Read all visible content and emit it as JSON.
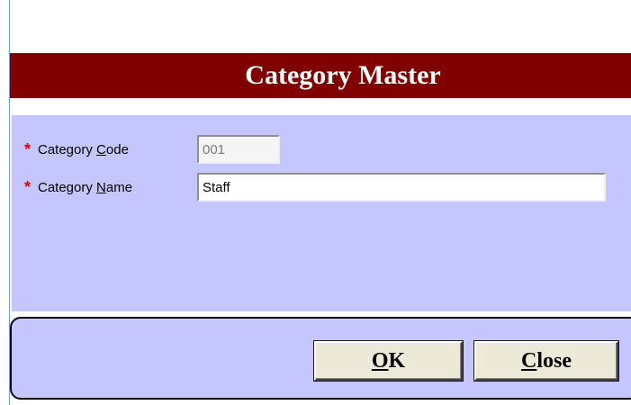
{
  "window": {
    "title": "Category Master",
    "title_bg": "#800000",
    "panel_bg": "#c6c6ff"
  },
  "form": {
    "code": {
      "required_mark": "*",
      "label_prefix": "Category ",
      "label_underlined": "C",
      "label_suffix": "ode",
      "value": "001"
    },
    "name": {
      "required_mark": "*",
      "label_prefix": "Category ",
      "label_underlined": "N",
      "label_suffix": "ame",
      "value": "Staff"
    }
  },
  "buttons": {
    "ok": {
      "underlined": "O",
      "rest": "K"
    },
    "close": {
      "underlined": "C",
      "rest": "lose"
    }
  }
}
